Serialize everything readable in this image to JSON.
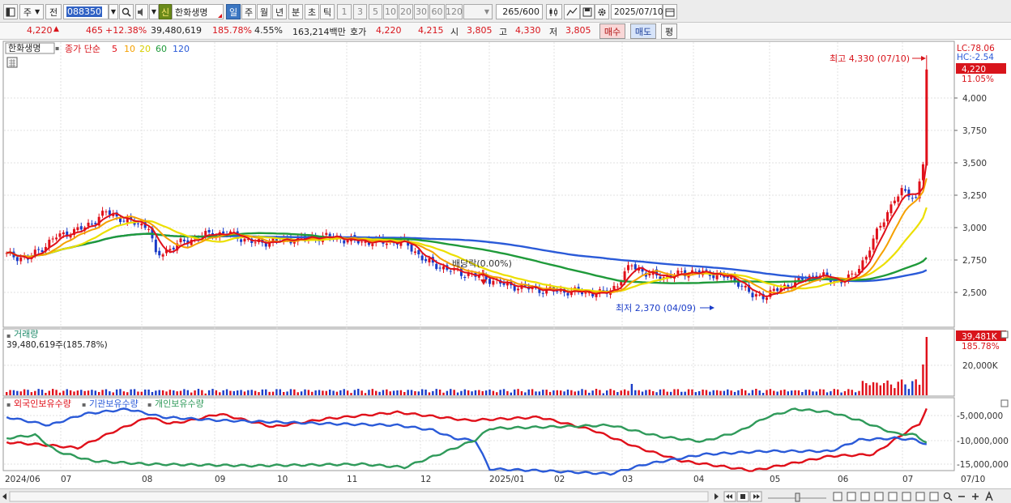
{
  "toolbar": {
    "market": "주",
    "prev": "전",
    "code": "088350",
    "new_badge": "신",
    "stock_name": "한화생명",
    "periods": [
      "일",
      "주",
      "월",
      "년",
      "분",
      "초",
      "틱"
    ],
    "minute_options": [
      "1",
      "3",
      "5",
      "10",
      "20",
      "30",
      "60",
      "120"
    ],
    "count": "265",
    "count_max": "/600",
    "date": "2025/07/10"
  },
  "info": {
    "price": "4,220",
    "change": "465",
    "change_pct": "+12.38%",
    "volume": "39,480,619",
    "volume_ratio": "185.78%",
    "turnover": "4.55%",
    "amount": "163,214백만",
    "ask_label": "호가",
    "ask": "4,220",
    "bid": "4,215",
    "open_label": "시",
    "open": "3,805",
    "high_label": "고",
    "high": "4,330",
    "low_label": "저",
    "low": "3,805",
    "buy_label": "매수",
    "sell_label": "매도",
    "eval_label": "평"
  },
  "price_panel": {
    "name": "한화생명",
    "ma_label": "종가 단순",
    "ma_periods": [
      "5",
      "10",
      "20",
      "60",
      "120"
    ],
    "ma_colors": [
      "#e0101a",
      "#f5a000",
      "#e8e000",
      "#1f9a3a",
      "#2a5ad8"
    ],
    "lc": "LC:78.06",
    "hc": "HC:-2.54",
    "last_price": "4,220",
    "last_pct": "11.05%",
    "y_ticks": [
      "4,000",
      "3,750",
      "3,500",
      "3,250",
      "3,000",
      "2,750",
      "2,500"
    ],
    "max_annotation": "최고 4,330 (07/10)",
    "min_annotation": "최저 2,370 (04/09)",
    "dividend_annotation": "배당락(0.00%)"
  },
  "volume_panel": {
    "title": "거래량",
    "value": "39,480,619주(185.78%)",
    "last_value": "39,481K",
    "last_pct": "185.78%",
    "y_ticks": [
      "20,000K"
    ]
  },
  "holding_panel": {
    "series": [
      "외국인보유수량",
      "기관보유수량",
      "개인보유수량"
    ],
    "colors": [
      "#e0101a",
      "#2a5ad8",
      "#2f9a5a"
    ],
    "y_ticks": [
      "-5,000,000",
      "-10,000,000",
      "-15,000,000"
    ]
  },
  "x_axis": [
    "2024/06",
    "07",
    "08",
    "09",
    "10",
    "11",
    "12",
    "2025/01",
    "02",
    "03",
    "04",
    "05",
    "06",
    "07"
  ],
  "x_axis_end": "07/10"
}
